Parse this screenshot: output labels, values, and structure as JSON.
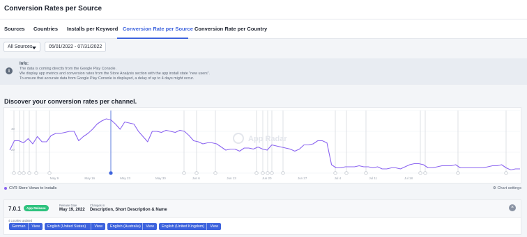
{
  "header": {
    "title": "Conversion Rates per Source"
  },
  "tabs": [
    {
      "label": "Sources"
    },
    {
      "label": "Countries"
    },
    {
      "label": "Installs per Keyword"
    },
    {
      "label": "Conversion Rate per Source",
      "active": true
    },
    {
      "label": "Conversion Rate per Country"
    }
  ],
  "filters": {
    "source_select": "All Sources",
    "date_range": "05/01/2022 - 07/31/2022"
  },
  "info": {
    "title": "Info:",
    "lines": [
      "The data is coming directly from the Google Play Console.",
      "We display app metrics and conversion rates from the Store Analysis section with the app install state \"new users\".",
      "To ensure that accurate data from Google Play Console is displayed, a delay of up to 4 days might occur."
    ]
  },
  "section": {
    "title": "Discover your conversion rates per channel."
  },
  "chart_data": {
    "type": "line",
    "series": [
      {
        "name": "CVR Store Views to Installs",
        "color": "#8a63f0",
        "values": [
          22,
          31,
          31,
          29,
          33,
          28,
          35,
          30,
          30,
          36,
          38,
          38,
          39,
          40,
          40,
          31,
          35,
          38,
          42,
          47,
          50,
          52,
          51,
          47,
          42,
          49,
          48,
          47,
          40,
          35,
          30,
          40,
          40,
          39,
          41,
          40,
          39,
          41,
          40,
          36,
          31,
          30,
          28,
          29,
          29,
          28,
          25,
          22,
          23,
          23,
          21,
          24,
          24,
          23,
          25,
          23,
          22,
          27,
          26,
          25,
          24,
          23,
          21,
          23,
          27,
          27,
          28,
          31,
          31,
          29,
          8,
          5,
          5,
          6,
          6,
          6,
          7,
          6,
          6,
          5,
          6,
          4,
          4,
          5,
          5,
          4,
          6,
          8,
          9,
          9,
          8,
          5,
          5,
          6,
          7,
          7,
          7,
          8,
          5,
          5,
          5,
          5,
          5,
          5,
          6,
          7,
          7,
          8,
          5,
          3,
          4,
          4
        ]
      }
    ],
    "x_tick_labels": [
      "May 9",
      "May 16",
      "May 23",
      "May 30",
      "Jun 6",
      "Jun 13",
      "Jun 20",
      "Jun 27",
      "Jul 4",
      "Jul 11",
      "Jul 18"
    ],
    "y_tick_labels": [
      "40",
      "20"
    ],
    "ylim": [
      0,
      60
    ],
    "grid": true,
    "watermark": "App Radar"
  },
  "legend": {
    "label": "CVR Store Views to Installs"
  },
  "chart_settings_label": "Chart settings",
  "release": {
    "version": "7.0.1",
    "badge": "App Release",
    "date_label": "Release Date",
    "date": "May 19, 2022",
    "changes_label": "Changes in",
    "changes": "Description, Short Description & Name",
    "close": "×",
    "locales_label": "4 Locales updated",
    "view_label": "View",
    "locales": [
      "German",
      "English (United States)",
      "English (Australia)",
      "English (United Kingdom)"
    ]
  },
  "icons": {
    "info": "info-icon",
    "caret": "caret-down-icon",
    "close": "close-icon",
    "settings": "gear-icon"
  },
  "colors": {
    "accent": "#3d63dd",
    "series": "#8a63f0",
    "badge": "#2ec27e"
  }
}
